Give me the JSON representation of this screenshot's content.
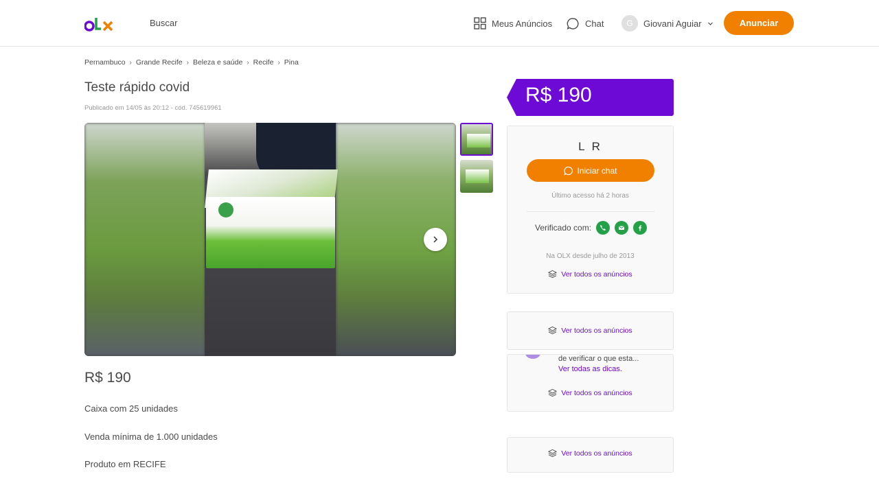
{
  "header": {
    "logo_text": "OLX",
    "search_label": "Buscar",
    "my_ads_label": "Meus Anúncios",
    "chat_label": "Chat",
    "user_initial": "G",
    "user_name": "Giovani Aguiar",
    "post_ad_label": "Anunciar"
  },
  "breadcrumb": [
    "Pernambuco",
    "Grande Recife",
    "Beleza e saúde",
    "Recife",
    "Pina"
  ],
  "ad": {
    "title": "Teste rápido covid",
    "published": "Publicado em 14/05 às 20:12 - cód. 745619961",
    "price": "R$ 190",
    "description": [
      "Caixa com 25 unidades",
      "Venda mínima de 1.000 unidades",
      "Produto em RECIFE"
    ]
  },
  "gallery": {
    "thumbnail_count": 2
  },
  "seller": {
    "price_tag": "R$ 190",
    "name": "L R",
    "chat_label": "Iniciar chat",
    "last_access": "Último acesso há 2 horas",
    "verified_label": "Verificado com:",
    "since": "Na OLX desde julho de 2013",
    "see_all_label": "Ver todos os anúncios"
  },
  "cards": [
    {
      "see_all_label": "Ver todos os anúncios"
    },
    {
      "tip_text": "de verificar o que esta...",
      "tip_link": "Ver todas as dicas.",
      "see_all_label": "Ver todos os anúncios"
    },
    {
      "see_all_label": "Ver todos os anúncios"
    }
  ],
  "colors": {
    "brand_purple": "#6e0ad6",
    "brand_orange": "#f28000",
    "verified_green": "#24a148"
  }
}
